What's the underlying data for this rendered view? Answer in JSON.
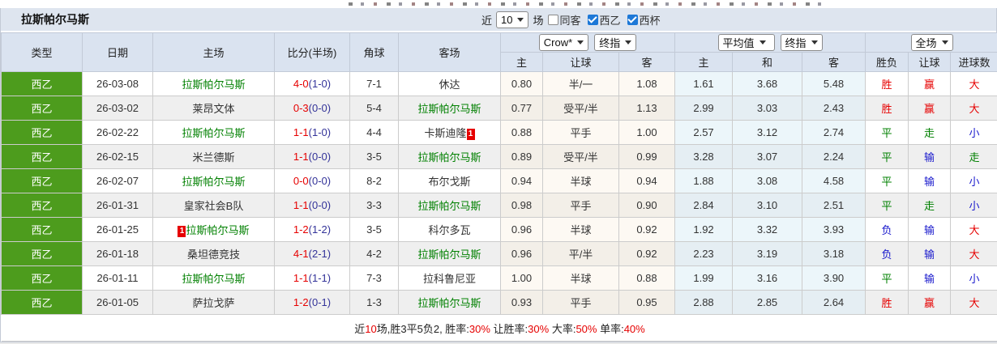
{
  "title_bar": {
    "team": "拉斯帕尔马斯",
    "recent_prefix": "近",
    "recent_select_value": "10",
    "recent_suffix": "场",
    "filters": [
      {
        "label": "同客",
        "checked": false
      },
      {
        "label": "西乙",
        "checked": true
      },
      {
        "label": "西杯",
        "checked": true
      }
    ]
  },
  "table": {
    "left_headers": [
      "类型",
      "日期",
      "主场",
      "比分(半场)",
      "角球",
      "客场"
    ],
    "group_selects": {
      "odds_book": "Crow*",
      "odds_stage": "终指",
      "avg_book": "平均值",
      "avg_stage": "终指",
      "result_scope": "全场"
    },
    "sub_headers": [
      "主",
      "让球",
      "客",
      "主",
      "和",
      "客",
      "胜负",
      "让球",
      "进球数"
    ],
    "rows": [
      {
        "league": "西乙",
        "date": "26-03-08",
        "home": {
          "name": "拉斯帕尔马斯",
          "green": true
        },
        "score": {
          "ft": "4-0",
          "ht": "(1-0)"
        },
        "corner": "7-1",
        "away": {
          "name": "休达",
          "green": false
        },
        "odds": [
          "0.80",
          "半/一",
          "1.08"
        ],
        "avg": [
          "1.61",
          "3.68",
          "5.48"
        ],
        "outcome": [
          {
            "text": "胜",
            "color": "red"
          },
          {
            "text": "赢",
            "color": "red"
          },
          {
            "text": "大",
            "color": "red"
          }
        ]
      },
      {
        "league": "西乙",
        "date": "26-03-02",
        "home": {
          "name": "莱昂文体",
          "green": false
        },
        "score": {
          "ft": "0-3",
          "ht": "(0-0)"
        },
        "corner": "5-4",
        "away": {
          "name": "拉斯帕尔马斯",
          "green": true
        },
        "odds": [
          "0.77",
          "受平/半",
          "1.13"
        ],
        "avg": [
          "2.99",
          "3.03",
          "2.43"
        ],
        "outcome": [
          {
            "text": "胜",
            "color": "red"
          },
          {
            "text": "赢",
            "color": "red"
          },
          {
            "text": "大",
            "color": "red"
          }
        ]
      },
      {
        "league": "西乙",
        "date": "26-02-22",
        "home": {
          "name": "拉斯帕尔马斯",
          "green": true
        },
        "score": {
          "ft": "1-1",
          "ht": "(1-0)"
        },
        "corner": "4-4",
        "away": {
          "name": "卡斯迪隆",
          "green": false,
          "badge_after": "1"
        },
        "odds": [
          "0.88",
          "平手",
          "1.00"
        ],
        "avg": [
          "2.57",
          "3.12",
          "2.74"
        ],
        "outcome": [
          {
            "text": "平",
            "color": "green"
          },
          {
            "text": "走",
            "color": "green"
          },
          {
            "text": "小",
            "color": "blue"
          }
        ]
      },
      {
        "league": "西乙",
        "date": "26-02-15",
        "home": {
          "name": "米兰德斯",
          "green": false
        },
        "score": {
          "ft": "1-1",
          "ht": "(0-0)"
        },
        "corner": "3-5",
        "away": {
          "name": "拉斯帕尔马斯",
          "green": true
        },
        "odds": [
          "0.89",
          "受平/半",
          "0.99"
        ],
        "avg": [
          "3.28",
          "3.07",
          "2.24"
        ],
        "outcome": [
          {
            "text": "平",
            "color": "green"
          },
          {
            "text": "输",
            "color": "blue"
          },
          {
            "text": "走",
            "color": "green"
          }
        ]
      },
      {
        "league": "西乙",
        "date": "26-02-07",
        "home": {
          "name": "拉斯帕尔马斯",
          "green": true
        },
        "score": {
          "ft": "0-0",
          "ht": "(0-0)"
        },
        "corner": "8-2",
        "away": {
          "name": "布尔戈斯",
          "green": false
        },
        "odds": [
          "0.94",
          "半球",
          "0.94"
        ],
        "avg": [
          "1.88",
          "3.08",
          "4.58"
        ],
        "outcome": [
          {
            "text": "平",
            "color": "green"
          },
          {
            "text": "输",
            "color": "blue"
          },
          {
            "text": "小",
            "color": "blue"
          }
        ]
      },
      {
        "league": "西乙",
        "date": "26-01-31",
        "home": {
          "name": "皇家社会B队",
          "green": false
        },
        "score": {
          "ft": "1-1",
          "ht": "(0-0)"
        },
        "corner": "3-3",
        "away": {
          "name": "拉斯帕尔马斯",
          "green": true
        },
        "odds": [
          "0.98",
          "平手",
          "0.90"
        ],
        "avg": [
          "2.84",
          "3.10",
          "2.51"
        ],
        "outcome": [
          {
            "text": "平",
            "color": "green"
          },
          {
            "text": "走",
            "color": "green"
          },
          {
            "text": "小",
            "color": "blue"
          }
        ]
      },
      {
        "league": "西乙",
        "date": "26-01-25",
        "home": {
          "name": "拉斯帕尔马斯",
          "green": true,
          "badge_before": "1"
        },
        "score": {
          "ft": "1-2",
          "ht": "(1-2)"
        },
        "corner": "3-5",
        "away": {
          "name": "科尔多瓦",
          "green": false
        },
        "odds": [
          "0.96",
          "半球",
          "0.92"
        ],
        "avg": [
          "1.92",
          "3.32",
          "3.93"
        ],
        "outcome": [
          {
            "text": "负",
            "color": "blue"
          },
          {
            "text": "输",
            "color": "blue"
          },
          {
            "text": "大",
            "color": "red"
          }
        ]
      },
      {
        "league": "西乙",
        "date": "26-01-18",
        "home": {
          "name": "桑坦德竞技",
          "green": false
        },
        "score": {
          "ft": "4-1",
          "ht": "(2-1)"
        },
        "corner": "4-2",
        "away": {
          "name": "拉斯帕尔马斯",
          "green": true
        },
        "odds": [
          "0.96",
          "平/半",
          "0.92"
        ],
        "avg": [
          "2.23",
          "3.19",
          "3.18"
        ],
        "outcome": [
          {
            "text": "负",
            "color": "blue"
          },
          {
            "text": "输",
            "color": "blue"
          },
          {
            "text": "大",
            "color": "red"
          }
        ]
      },
      {
        "league": "西乙",
        "date": "26-01-11",
        "home": {
          "name": "拉斯帕尔马斯",
          "green": true
        },
        "score": {
          "ft": "1-1",
          "ht": "(1-1)"
        },
        "corner": "7-3",
        "away": {
          "name": "拉科鲁尼亚",
          "green": false
        },
        "odds": [
          "1.00",
          "半球",
          "0.88"
        ],
        "avg": [
          "1.99",
          "3.16",
          "3.90"
        ],
        "outcome": [
          {
            "text": "平",
            "color": "green"
          },
          {
            "text": "输",
            "color": "blue"
          },
          {
            "text": "小",
            "color": "blue"
          }
        ]
      },
      {
        "league": "西乙",
        "date": "26-01-05",
        "home": {
          "name": "萨拉戈萨",
          "green": false
        },
        "score": {
          "ft": "1-2",
          "ht": "(0-1)"
        },
        "corner": "1-3",
        "away": {
          "name": "拉斯帕尔马斯",
          "green": true
        },
        "odds": [
          "0.93",
          "平手",
          "0.95"
        ],
        "avg": [
          "2.88",
          "2.85",
          "2.64"
        ],
        "outcome": [
          {
            "text": "胜",
            "color": "red"
          },
          {
            "text": "赢",
            "color": "red"
          },
          {
            "text": "大",
            "color": "red"
          }
        ]
      }
    ]
  },
  "footer": {
    "segments": [
      {
        "text": "近",
        "color": "black"
      },
      {
        "text": "10",
        "color": "red"
      },
      {
        "text": "场,胜3平5负2, 胜率:",
        "color": "black"
      },
      {
        "text": "30%",
        "color": "red"
      },
      {
        "text": " 让胜率:",
        "color": "black"
      },
      {
        "text": "30%",
        "color": "red"
      },
      {
        "text": " 大率:",
        "color": "black"
      },
      {
        "text": "50%",
        "color": "red"
      },
      {
        "text": " 单率:",
        "color": "black"
      },
      {
        "text": "40%",
        "color": "red"
      }
    ]
  }
}
